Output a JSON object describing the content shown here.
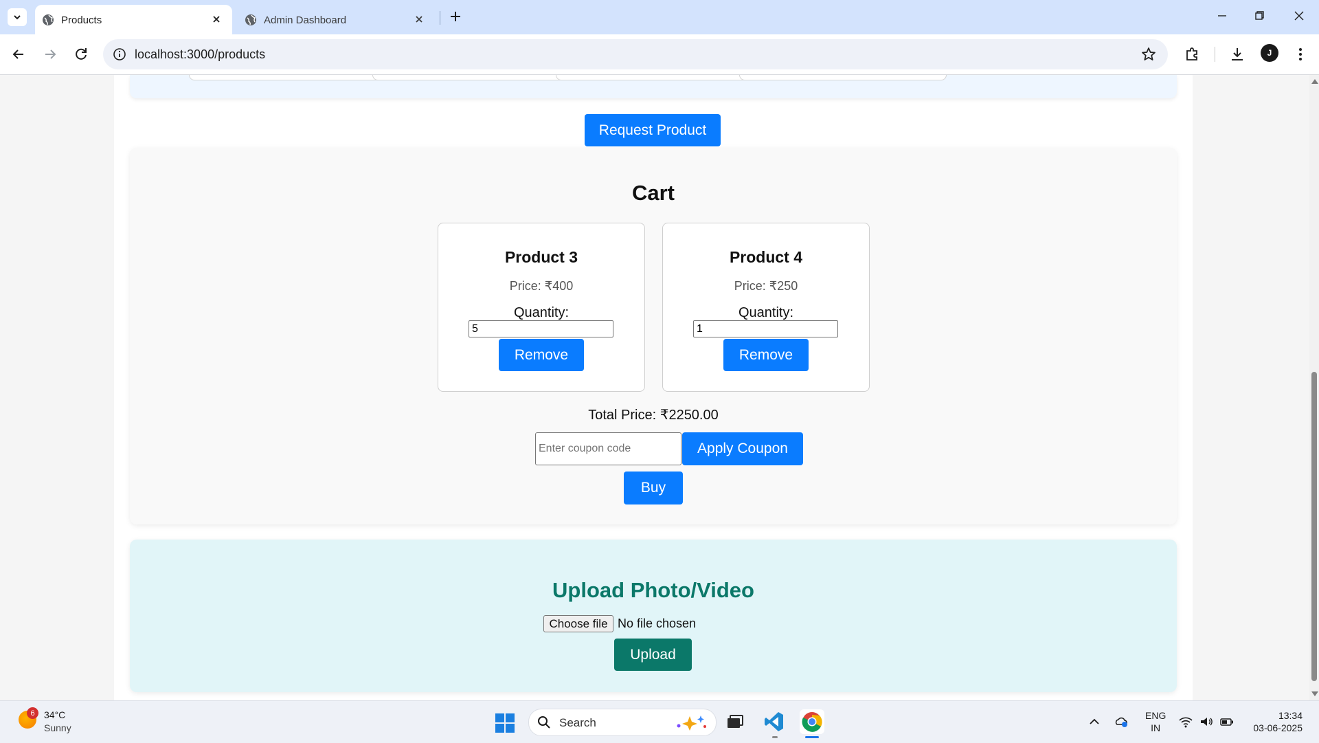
{
  "browser": {
    "tabs": [
      {
        "title": "Products",
        "active": true
      },
      {
        "title": "Admin Dashboard",
        "active": false
      }
    ],
    "url": "localhost:3000/products",
    "profile_initial": "J"
  },
  "page": {
    "request_product_label": "Request Product",
    "cart": {
      "title": "Cart",
      "items": [
        {
          "name": "Product 3",
          "price": "Price: ₹400",
          "quantity_label": "Quantity:",
          "quantity": "5",
          "remove_label": "Remove"
        },
        {
          "name": "Product 4",
          "price": "Price: ₹250",
          "quantity_label": "Quantity:",
          "quantity": "1",
          "remove_label": "Remove"
        }
      ],
      "total": "Total Price: ₹2250.00",
      "coupon_placeholder": "Enter coupon code",
      "apply_coupon_label": "Apply Coupon",
      "buy_label": "Buy"
    },
    "upload": {
      "title": "Upload Photo/Video",
      "choose_file_label": "Choose file",
      "file_status": "No file chosen",
      "upload_label": "Upload"
    }
  },
  "taskbar": {
    "weather": {
      "badge": "6",
      "temperature": "34°C",
      "condition": "Sunny"
    },
    "search_label": "Search",
    "language": {
      "line1": "ENG",
      "line2": "IN"
    },
    "clock": {
      "time": "13:34",
      "date": "03-06-2025"
    }
  },
  "colors": {
    "accent_blue": "#0a7cff",
    "upload_green": "#0b7869",
    "tabbar": "#d3e3fd"
  }
}
